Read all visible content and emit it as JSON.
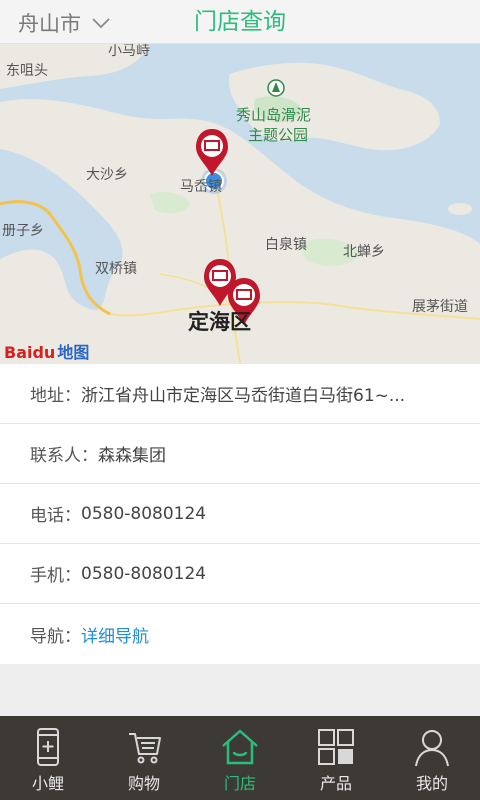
{
  "header": {
    "city": "舟山市",
    "title": "门店查询"
  },
  "map": {
    "labels": {
      "xiaomaqi": "小马峙",
      "dongzuitou": "东咀头",
      "xiushan": "秀山岛滑泥",
      "xiushan2": "主题公园",
      "dashaxiang": "大沙乡",
      "maao": "马岙镇",
      "cezi": "册子乡",
      "baiquan": "白泉镇",
      "beichan": "北蝉乡",
      "shuangqiao": "双桥镇",
      "zhanmao": "展茅街道",
      "dinghai": "定海区"
    },
    "logo_baidu": "Baidu",
    "logo_map": "地图"
  },
  "store": {
    "address_label": "地址：",
    "address": "浙江省舟山市定海区马岙街道白马街61~...",
    "contact_label": "联系人：",
    "contact": "森森集团",
    "phone_label": "电话：",
    "phone": "0580-8080124",
    "mobile_label": "手机：",
    "mobile": "0580-8080124",
    "nav_label": "导航：",
    "nav_link": "详细导航"
  },
  "tabs": [
    {
      "label": "小鲤",
      "icon": "phone-add-icon"
    },
    {
      "label": "购物",
      "icon": "cart-icon"
    },
    {
      "label": "门店",
      "icon": "store-icon",
      "active": true
    },
    {
      "label": "产品",
      "icon": "grid-icon"
    },
    {
      "label": "我的",
      "icon": "user-icon"
    }
  ],
  "colors": {
    "accent": "#2bbd7d",
    "link": "#1e8fd8",
    "tabbar": "#3d3a35",
    "pin": "#c0172c"
  }
}
